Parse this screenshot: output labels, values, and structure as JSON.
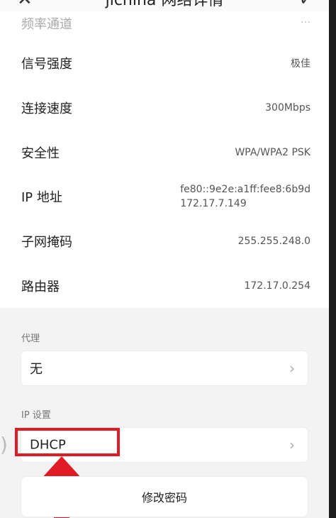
{
  "header": {
    "title": "jichina 网络详情",
    "back_glyph": "✕",
    "confirm_glyph": "✓"
  },
  "rows": [
    {
      "label": "信号强度",
      "value": "极佳"
    },
    {
      "label": "连接速度",
      "value": "300Mbps"
    },
    {
      "label": "安全性",
      "value": "WPA/WPA2 PSK"
    },
    {
      "label": "IP 地址",
      "value_line1": "fe80::9e2e:a1ff:fee8:6b9d",
      "value_line2": "172.17.7.149"
    },
    {
      "label": "子网掩码",
      "value": "255.255.248.0"
    },
    {
      "label": "路由器",
      "value": "172.17.0.254"
    }
  ],
  "partial_row": {
    "label": "频率通道",
    "value": "…"
  },
  "proxy": {
    "section_label": "代理",
    "value": "无"
  },
  "ip_settings": {
    "section_label": "IP 设置",
    "value": "DHCP"
  },
  "change_password_label": "修改密码",
  "colors": {
    "highlight": "#e11b26",
    "arrow": "#e11b26"
  }
}
